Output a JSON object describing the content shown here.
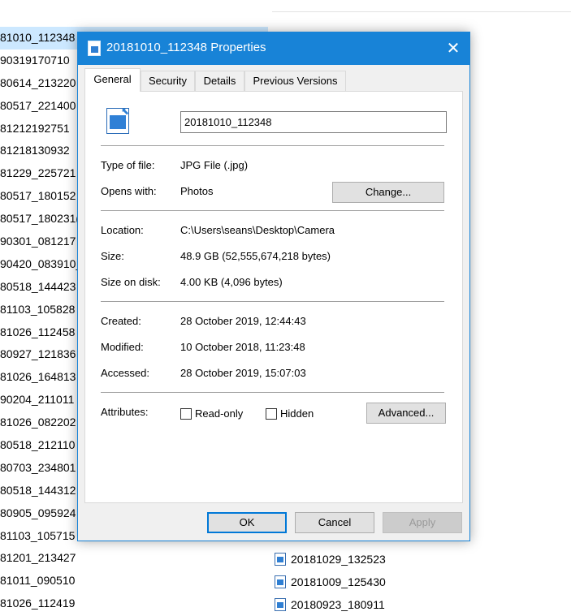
{
  "background": {
    "left_files": [
      "81010_112348",
      "90319170710",
      "80614_213220",
      "80517_221400",
      "81212192751",
      "81218130932",
      "81229_225721",
      "80517_180152",
      "80517_180231(",
      "90301_081217",
      "90420_083910_",
      "80518_144423",
      "81103_105828",
      "81026_112458",
      "80927_121836",
      "81026_164813",
      "90204_211011",
      "81026_082202",
      "80518_212110",
      "80703_234801",
      "80518_144312",
      "80905_095924",
      "81103_105715",
      "81201_213427",
      "81011_090510",
      "81026_112419"
    ],
    "right_files": [
      "20181029_132523",
      "20181009_125430",
      "20180923_180911"
    ]
  },
  "dialog": {
    "title": "20181010_112348 Properties",
    "close_glyph": "✕",
    "tabs": [
      "General",
      "Security",
      "Details",
      "Previous Versions"
    ],
    "filename": "20181010_112348",
    "type_label": "Type of file:",
    "type_value": "JPG File (.jpg)",
    "opens_label": "Opens with:",
    "opens_value": "Photos",
    "change_button": "Change...",
    "location_label": "Location:",
    "location_value": "C:\\Users\\seans\\Desktop\\Camera",
    "size_label": "Size:",
    "size_value": "48.9 GB (52,555,674,218 bytes)",
    "size_disk_label": "Size on disk:",
    "size_disk_value": "4.00 KB (4,096 bytes)",
    "created_label": "Created:",
    "created_value": "28 October 2019, 12:44:43",
    "modified_label": "Modified:",
    "modified_value": "10 October 2018, 11:23:48",
    "accessed_label": "Accessed:",
    "accessed_value": "28 October 2019, 15:07:03",
    "attributes_label": "Attributes:",
    "readonly_label": "Read-only",
    "hidden_label": "Hidden",
    "advanced_button": "Advanced...",
    "ok_button": "OK",
    "cancel_button": "Cancel",
    "apply_button": "Apply"
  },
  "colors": {
    "title_bar": "#1883d7",
    "selection": "#cce8ff",
    "focus_border": "#0078d7"
  }
}
